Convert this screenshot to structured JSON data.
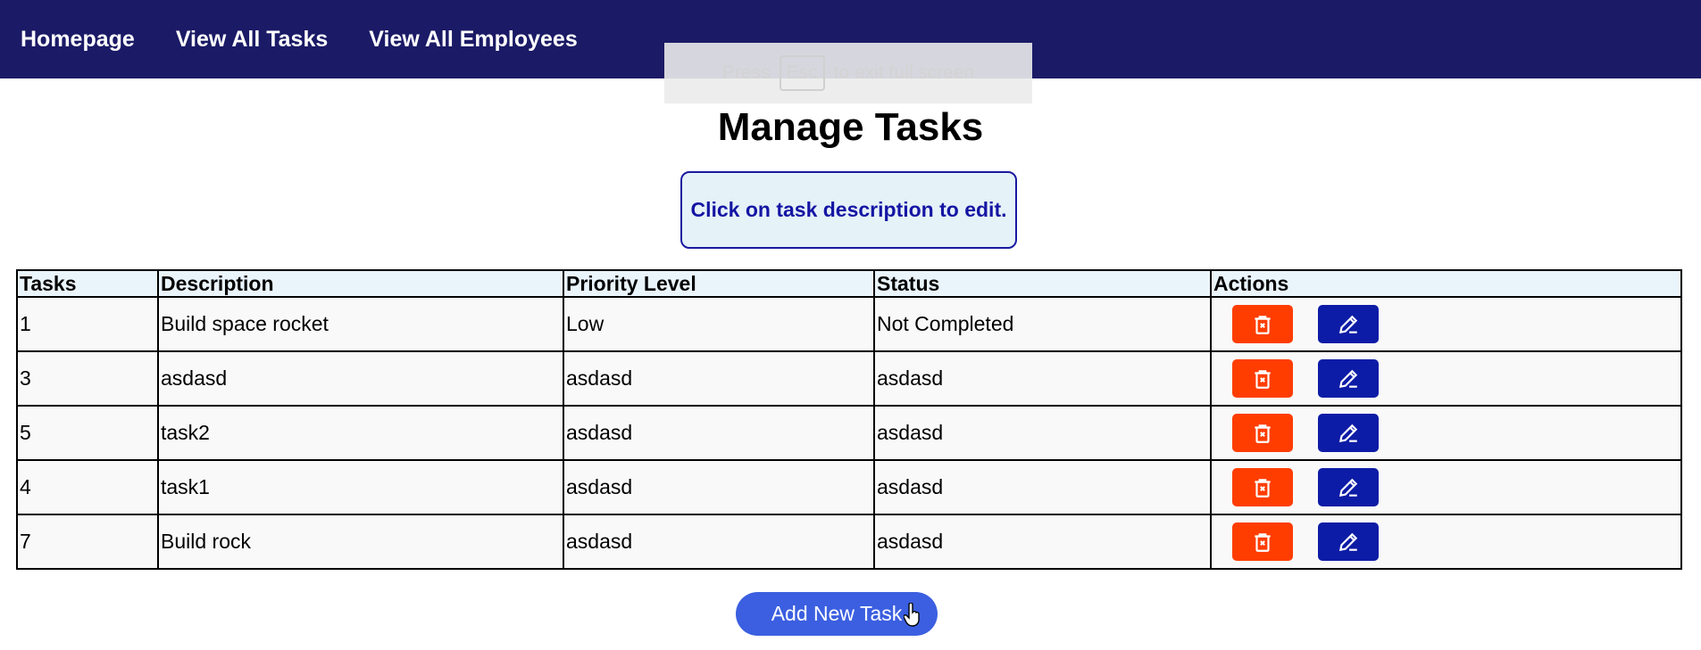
{
  "nav": {
    "items": [
      {
        "label": "Homepage"
      },
      {
        "label": "View All Tasks"
      },
      {
        "label": "View All Employees"
      }
    ]
  },
  "fullscreen_notice": {
    "press": "Press",
    "key": "Esc",
    "rest": "to exit full screen"
  },
  "page": {
    "title": "Manage Tasks",
    "hint": "Click on task description to edit."
  },
  "table": {
    "headers": [
      "Tasks",
      "Description",
      "Priority Level",
      "Status",
      "Actions"
    ],
    "rows": [
      {
        "id": "1",
        "description": "Build space rocket",
        "priority": "Low",
        "status": "Not Completed"
      },
      {
        "id": "3",
        "description": "asdasd",
        "priority": "asdasd",
        "status": "asdasd"
      },
      {
        "id": "5",
        "description": "task2",
        "priority": "asdasd",
        "status": "asdasd"
      },
      {
        "id": "4",
        "description": "task1",
        "priority": "asdasd",
        "status": "asdasd"
      },
      {
        "id": "7",
        "description": "Build rock",
        "priority": "asdasd",
        "status": "asdasd"
      }
    ],
    "action_icons": {
      "delete": "trash-icon",
      "edit": "pencil-icon"
    }
  },
  "add_button": {
    "label": "Add New Task"
  },
  "colors": {
    "navbar": "#1b1a66",
    "delete": "#ff3d00",
    "edit": "#0d1ca6",
    "add": "#3b5fe0",
    "hint_border": "#1a1aa0",
    "hint_bg": "#e5f2f8"
  }
}
